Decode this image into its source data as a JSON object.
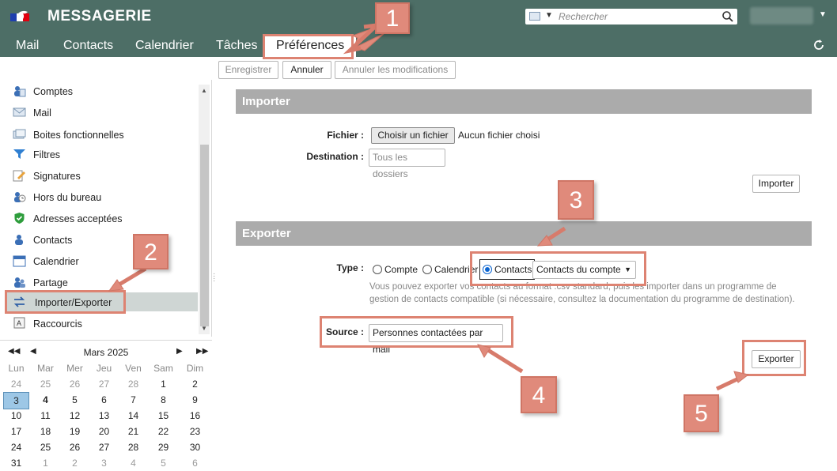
{
  "header": {
    "app_title": "MESSAGERIE",
    "search_placeholder": "Rechercher",
    "tabs": [
      "Mail",
      "Contacts",
      "Calendrier",
      "Tâches",
      "Préférences"
    ],
    "active_tab": "Préférences",
    "colors": {
      "header_bg": "#4d6e66",
      "accent": "#dd8372"
    }
  },
  "toolbar": {
    "save_label": "Enregistrer",
    "cancel_label": "Annuler",
    "undo_label": "Annuler les modifications"
  },
  "sidebar": {
    "items": [
      {
        "label": "Comptes",
        "icon": "accounts-icon"
      },
      {
        "label": "Mail",
        "icon": "mail-icon"
      },
      {
        "label": "Boites fonctionnelles",
        "icon": "mailboxes-icon"
      },
      {
        "label": "Filtres",
        "icon": "filter-icon"
      },
      {
        "label": "Signatures",
        "icon": "signature-icon"
      },
      {
        "label": "Hors du bureau",
        "icon": "out-of-office-icon"
      },
      {
        "label": "Adresses acceptées",
        "icon": "shield-check-icon"
      },
      {
        "label": "Contacts",
        "icon": "contact-icon"
      },
      {
        "label": "Calendrier",
        "icon": "calendar-icon"
      },
      {
        "label": "Partage",
        "icon": "share-icon"
      },
      {
        "label": "Importer/Exporter",
        "icon": "import-export-icon"
      },
      {
        "label": "Raccourcis",
        "icon": "keyboard-shortcut-icon"
      }
    ],
    "active_item": "Importer/Exporter"
  },
  "calendar": {
    "title": "Mars 2025",
    "weekdays": [
      "Lun",
      "Mar",
      "Mer",
      "Jeu",
      "Ven",
      "Sam",
      "Dim"
    ],
    "weeks": [
      [
        "24",
        "25",
        "26",
        "27",
        "28",
        "1",
        "2"
      ],
      [
        "3",
        "4",
        "5",
        "6",
        "7",
        "8",
        "9"
      ],
      [
        "10",
        "11",
        "12",
        "13",
        "14",
        "15",
        "16"
      ],
      [
        "17",
        "18",
        "19",
        "20",
        "21",
        "22",
        "23"
      ],
      [
        "24",
        "25",
        "26",
        "27",
        "28",
        "29",
        "30"
      ],
      [
        "31",
        "1",
        "2",
        "3",
        "4",
        "5",
        "6"
      ]
    ],
    "today": "3"
  },
  "import": {
    "section_title": "Importer",
    "file_label": "Fichier :",
    "file_button": "Choisir un fichier",
    "file_status": "Aucun fichier choisi",
    "destination_label": "Destination :",
    "destination_value": "Tous les dossiers",
    "import_button": "Importer"
  },
  "export": {
    "section_title": "Exporter",
    "type_label": "Type :",
    "type_options": [
      "Compte",
      "Calendrier",
      "Contacts"
    ],
    "type_selected": "Contacts",
    "contacts_select_value": "Contacts du compte",
    "help_text": "Vous pouvez exporter vos contacts au format .csv standard, puis les importer dans un programme de gestion de contacts compatible (si nécessaire, consultez la documentation du programme de destination).",
    "source_label": "Source :",
    "source_value": "Personnes contactées par mail",
    "export_button": "Exporter"
  },
  "annotations": {
    "steps": [
      "1",
      "2",
      "3",
      "4",
      "5"
    ]
  }
}
